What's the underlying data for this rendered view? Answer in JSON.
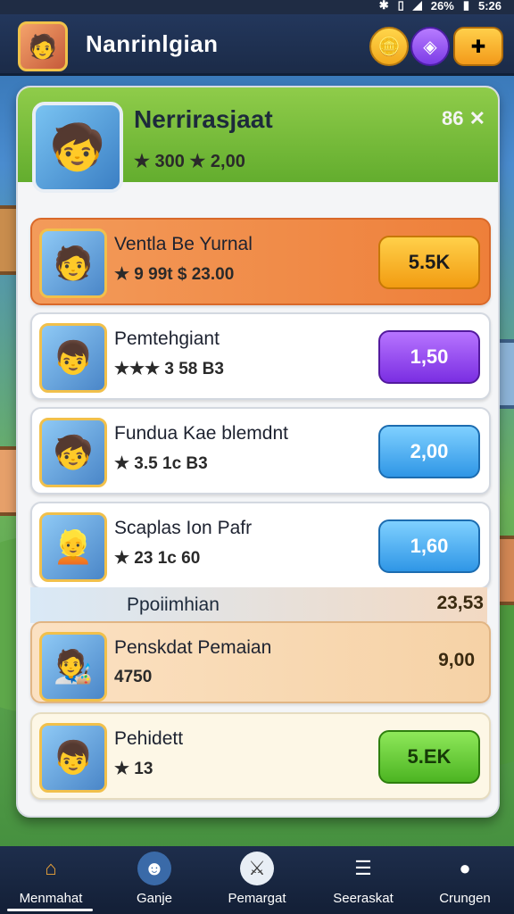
{
  "status": {
    "battery": "26%",
    "time": "5:26"
  },
  "top": {
    "title": "Nanrinlgian"
  },
  "header": {
    "title": "Nerrirasjaat",
    "subtitle": "★ 300 ★ 2,00"
  },
  "rows": [
    {
      "title": "Ventla Be Yurnal",
      "meta": "★ 9 99t $ 23.00",
      "button": "5.5K"
    },
    {
      "title": "Pemtehgiant",
      "meta": "★★★ 3 58 B3",
      "button": "1,50"
    },
    {
      "title": "Fundua Kae blemdnt",
      "meta": "★ 3.5 1c B3",
      "button": "2,00"
    },
    {
      "title": "Scaplas Ion Pafr",
      "meta": "★ 23 1c 60",
      "button": "1,60"
    }
  ],
  "section": {
    "title": "Ppoiimhian",
    "right": "23,53"
  },
  "special": {
    "title": "Penskdat Pemaian",
    "meta": "4750",
    "price": "9,00"
  },
  "last": {
    "title": "Pehidett",
    "meta": "★ 13",
    "button": "5.EK"
  },
  "nav": [
    "Menmahat",
    "Ganje",
    "Pemargat",
    "Seeraskat",
    "Crungen"
  ]
}
